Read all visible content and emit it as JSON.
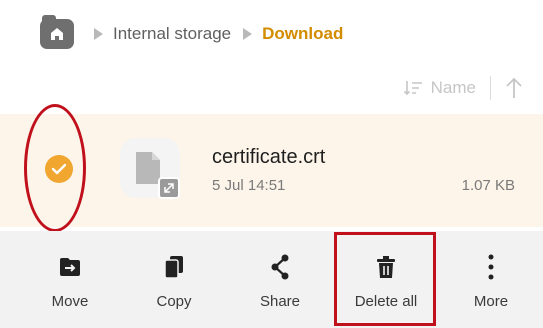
{
  "breadcrumb": {
    "home_icon": "home-icon",
    "items": [
      "Internal storage",
      "Download"
    ]
  },
  "sort": {
    "label": "Name",
    "sort_icon": "sort-icon",
    "direction_icon": "arrow-up-icon"
  },
  "file": {
    "name": "certificate.crt",
    "date": "5 Jul 14:51",
    "size": "1.07 KB",
    "selected": true,
    "icon": "document-icon",
    "badge_icon": "expand-icon"
  },
  "actions": [
    {
      "label": "Move",
      "icon": "move-icon"
    },
    {
      "label": "Copy",
      "icon": "copy-icon"
    },
    {
      "label": "Share",
      "icon": "share-icon"
    },
    {
      "label": "Delete all",
      "icon": "trash-icon"
    },
    {
      "label": "More",
      "icon": "more-vertical-icon"
    }
  ],
  "colors": {
    "accent": "#d38b00",
    "check": "#f0a62f",
    "selected_row": "#fdf5ea",
    "annotation": "#c0101c",
    "action_bar": "#f2f2f2"
  }
}
